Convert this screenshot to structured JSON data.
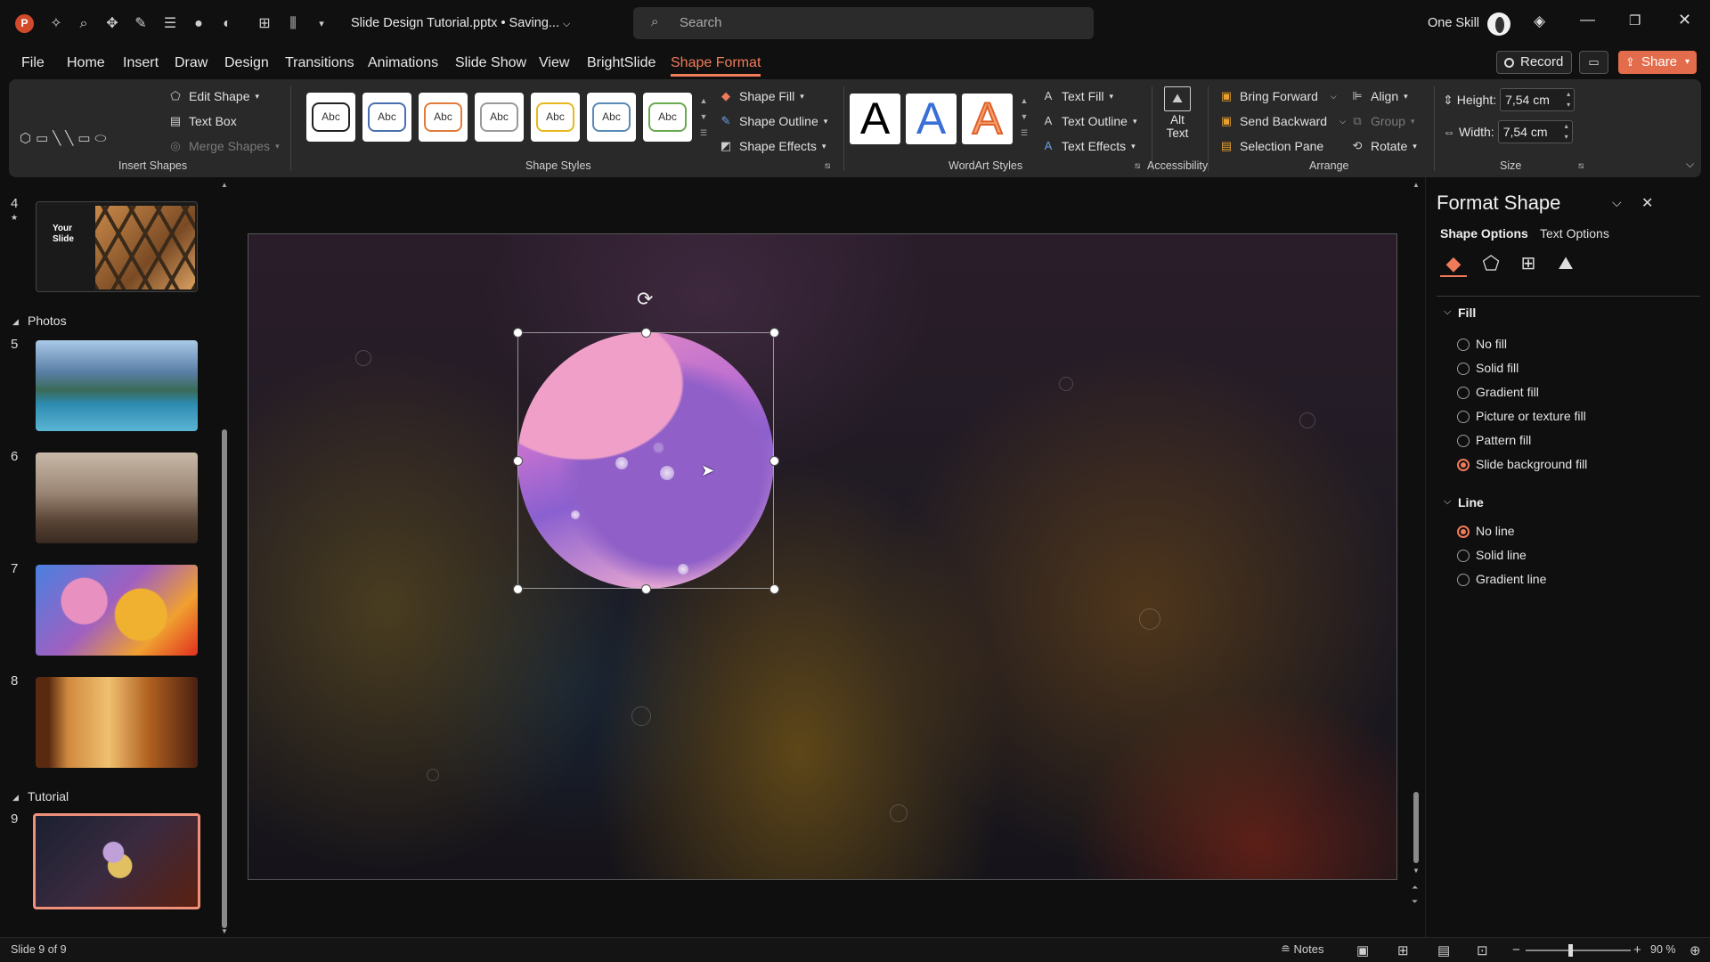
{
  "title_bar": {
    "file_title": "Slide Design Tutorial.pptx • Saving...",
    "search_placeholder": "Search",
    "user_name": "One Skill"
  },
  "menu": {
    "tabs": [
      "File",
      "Home",
      "Insert",
      "Draw",
      "Design",
      "Transitions",
      "Animations",
      "Slide Show",
      "View",
      "BrightSlide",
      "Shape Format"
    ],
    "active_tab": "Shape Format",
    "record_label": "Record",
    "share_label": "Share"
  },
  "ribbon": {
    "insert_shapes": {
      "edit_shape": "Edit Shape",
      "text_box": "Text Box",
      "merge_shapes": "Merge Shapes",
      "label": "Insert Shapes"
    },
    "shape_styles": {
      "swatches": [
        "Abc",
        "Abc",
        "Abc",
        "Abc",
        "Abc",
        "Abc",
        "Abc"
      ],
      "shape_fill": "Shape Fill",
      "shape_outline": "Shape Outline",
      "shape_effects": "Shape Effects",
      "label": "Shape Styles"
    },
    "wordart": {
      "letters": [
        "A",
        "A",
        "A"
      ],
      "text_fill": "Text Fill",
      "text_outline": "Text Outline",
      "text_effects": "Text Effects",
      "label": "WordArt Styles"
    },
    "accessibility": {
      "alt_text_line1": "Alt",
      "alt_text_line2": "Text",
      "label": "Accessibility"
    },
    "arrange": {
      "bring_forward": "Bring Forward",
      "send_backward": "Send Backward",
      "selection_pane": "Selection Pane",
      "align": "Align",
      "group": "Group",
      "rotate": "Rotate",
      "label": "Arrange"
    },
    "size": {
      "height_label": "Height:",
      "height_value": "7,54 cm",
      "width_label": "Width:",
      "width_value": "7,54 cm",
      "label": "Size"
    }
  },
  "slides_panel": {
    "sections": [
      "Photos",
      "Tutorial"
    ],
    "slide_numbers": [
      "4",
      "5",
      "6",
      "7",
      "8",
      "9"
    ],
    "slide4_text_line1": "Your",
    "slide4_text_line2": "Slide"
  },
  "format_pane": {
    "title": "Format Shape",
    "tab_shape_options": "Shape Options",
    "tab_text_options": "Text Options",
    "fill_heading": "Fill",
    "fill_options": [
      "No fill",
      "Solid fill",
      "Gradient fill",
      "Picture or texture fill",
      "Pattern fill",
      "Slide background fill"
    ],
    "fill_selected": "Slide background fill",
    "line_heading": "Line",
    "line_options": [
      "No line",
      "Solid line",
      "Gradient line"
    ],
    "line_selected": "No line"
  },
  "status_bar": {
    "slide_info": "Slide 9 of 9",
    "notes_label": "Notes",
    "zoom": "90 %"
  },
  "colors": {
    "accent": "#f07b5a",
    "ribbon_bg": "#292929",
    "app_bg": "#0f0f0f"
  }
}
